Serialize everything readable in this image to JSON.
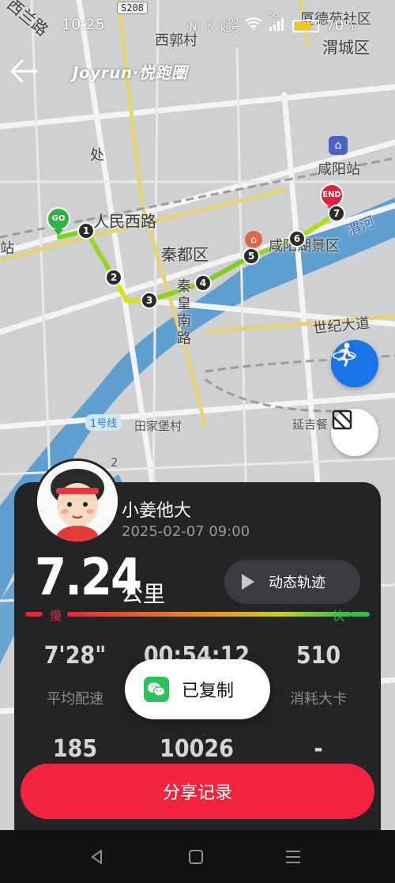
{
  "status_bar": {
    "time": "10:25",
    "net_speed": "4.00\nKB/S",
    "signal": "5G",
    "battery_pct": "70%",
    "battery_level": 0.7
  },
  "header": {
    "brand": "Joyrun·悦跑圈"
  },
  "map": {
    "labels": {
      "xilanlu": "西兰路",
      "road_s208": "S208",
      "xiguocun": "西郭村",
      "xiadeyuan": "厦德苑社区",
      "weicheng": "渭城区",
      "chu": "处",
      "xianyang_station": "咸阳站",
      "renmin_xilu": "人民西路",
      "qindu": "秦都区",
      "xianyang_scenic": "咸阳湖景区",
      "weihe": "渭河",
      "qinhuang_nanlu": "秦皇南路",
      "shiji_dadao": "世纪大道",
      "metro_line1": "1号线",
      "tianjiabao": "田家堡村",
      "yanjiwan": "延吉餐",
      "zhan": "站",
      "num_2": "2"
    },
    "route_markers": {
      "start": "GO",
      "end": "END",
      "checkpoints": [
        "1",
        "2",
        "3",
        "4",
        "5",
        "6",
        "7"
      ]
    }
  },
  "record": {
    "user_name": "小姜他大",
    "date": "2025-02-07 09:00",
    "distance": "7.24",
    "distance_unit": "公里",
    "replay_label": "动态轨迹",
    "slow_label": "慢",
    "fast_label": "快",
    "stats": [
      {
        "value": "7'28\"",
        "label": "平均配速"
      },
      {
        "value": "00:54:12",
        "label": ""
      },
      {
        "value": "510",
        "label": "消耗大卡"
      },
      {
        "value": "185",
        "label": ""
      },
      {
        "value": "10026",
        "label": ""
      },
      {
        "value": "-",
        "label": ""
      }
    ],
    "share_label": "分享记录"
  },
  "toast": {
    "message": "已复制"
  },
  "colors": {
    "accent_red": "#f2243f",
    "route_green": "#7fd320",
    "route_yellow": "#d6e21a",
    "river": "#5f9fcf",
    "card_bg": "#242427"
  }
}
